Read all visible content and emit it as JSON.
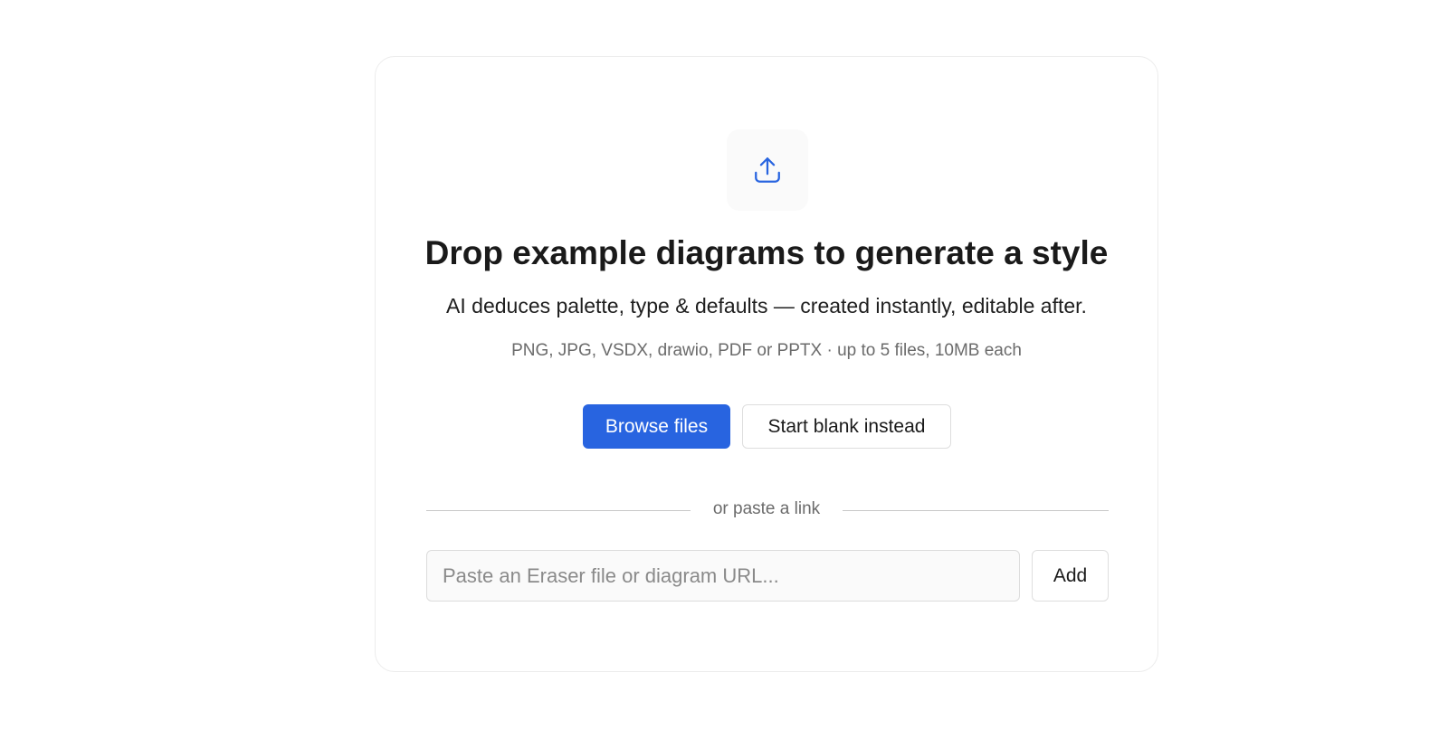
{
  "upload": {
    "icon": "upload-icon",
    "icon_color": "#2864e0",
    "heading": "Drop example diagrams to generate a style",
    "subheading": "AI deduces palette, type & defaults — created instantly, editable after.",
    "formats": "PNG, JPG, VSDX, drawio, PDF or PPTX · up to 5 files, 10MB each"
  },
  "actions": {
    "browse_label": "Browse files",
    "blank_label": "Start blank instead",
    "primary_color": "#2864e0"
  },
  "divider": {
    "label": "or paste a link"
  },
  "link": {
    "value": "",
    "placeholder": "Paste an Eraser file or diagram URL...",
    "add_label": "Add"
  }
}
